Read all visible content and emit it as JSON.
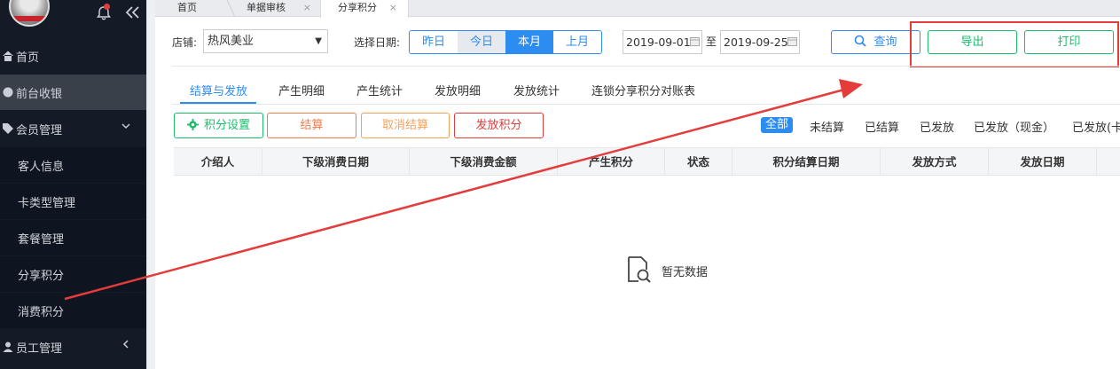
{
  "sidebar": {
    "items": [
      {
        "label": "首页"
      },
      {
        "label": "前台收银"
      },
      {
        "label": "会员管理"
      },
      {
        "label": "客人信息"
      },
      {
        "label": "卡类型管理"
      },
      {
        "label": "套餐管理"
      },
      {
        "label": "分享积分"
      },
      {
        "label": "消费积分"
      },
      {
        "label": "员工管理"
      }
    ]
  },
  "tabs": [
    {
      "label": "首页"
    },
    {
      "label": "单据审核",
      "close": "×"
    },
    {
      "label": "分享积分",
      "close": "×"
    }
  ],
  "filter": {
    "store_label": "店铺:",
    "store_value": "热风美业",
    "date_label": "选择日期:",
    "ranges": [
      "昨日",
      "今日",
      "本月",
      "上月"
    ],
    "start_date": "2019-09-01",
    "to": "至",
    "end_date": "2019-09-25",
    "query": "查询",
    "export": "导出",
    "print": "打印"
  },
  "subtabs": [
    "结算与发放",
    "产生明细",
    "产生统计",
    "发放明细",
    "发放统计",
    "连锁分享积分对账表"
  ],
  "actions": {
    "settings": "积分设置",
    "settle": "结算",
    "cancel": "取消结算",
    "issue": "发放积分"
  },
  "status_filters": [
    "全部",
    "未结算",
    "已结算",
    "已发放",
    "已发放（现金）",
    "已发放(卡"
  ],
  "table": {
    "headers": [
      "介绍人",
      "下级消费日期",
      "下级消费金额",
      "产生积分",
      "状态",
      "积分结算日期",
      "发放方式",
      "发放日期"
    ],
    "empty": "暂无数据"
  },
  "colors": {
    "primary": "#2d8cf0",
    "success": "#19be6b",
    "danger": "#e43b3b",
    "sidebar": "#141b26"
  }
}
